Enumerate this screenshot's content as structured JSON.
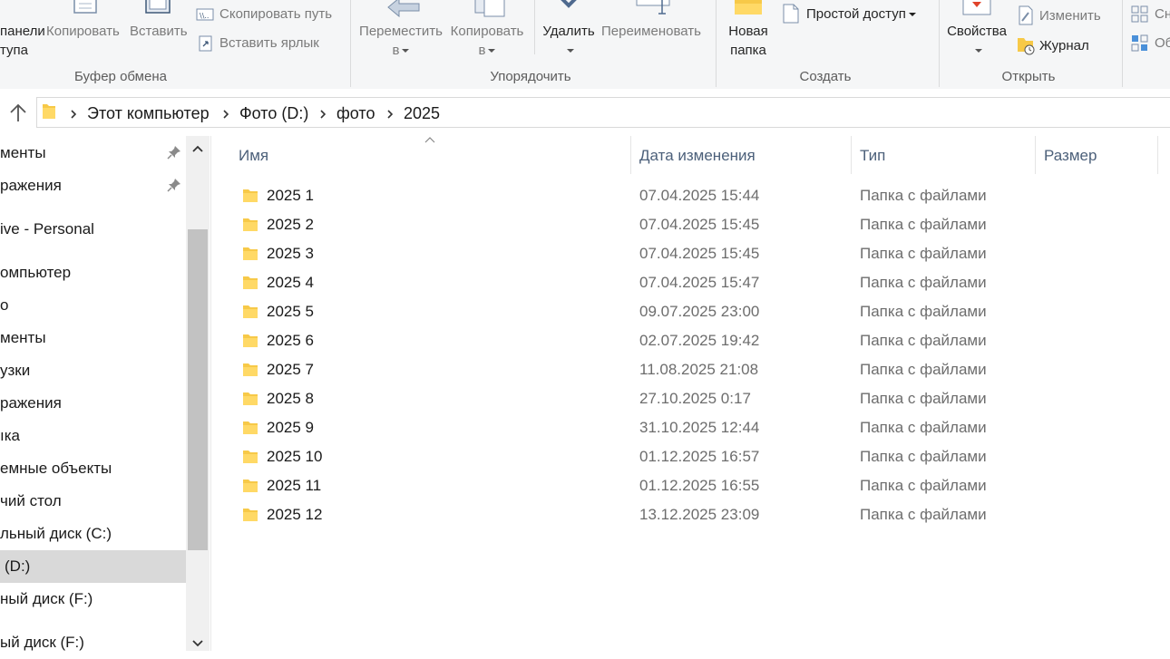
{
  "ribbon": {
    "clipboard": {
      "pin_label_line1": "панели",
      "pin_label_line2": "тупа",
      "copy_label": "Копировать",
      "paste_label": "Вставить",
      "copy_path_label": "Скопировать путь",
      "paste_shortcut_label": "Вставить ярлык",
      "group_label": "Буфер обмена"
    },
    "organize": {
      "move_to_line1": "Переместить",
      "move_to_line2": "в",
      "copy_to_line1": "Копировать",
      "copy_to_line2": "в",
      "delete_label": "Удалить",
      "rename_label": "Переименовать",
      "group_label": "Упорядочить"
    },
    "create": {
      "new_folder_line1": "Новая",
      "new_folder_line2": "папка",
      "easy_access_label": "Простой доступ",
      "group_label": "Создать"
    },
    "open": {
      "properties_label": "Свойства",
      "edit_label": "Изменить",
      "history_label": "Журнал",
      "group_label": "Открыть"
    },
    "select": {
      "item1": "Сн",
      "item2": "Об"
    }
  },
  "address": {
    "crumbs": [
      "Этот компьютер",
      "Фото (D:)",
      "фото",
      "2025"
    ]
  },
  "nav": {
    "items": [
      {
        "label": "менты",
        "pinned": true
      },
      {
        "label": "ражения",
        "pinned": true
      },
      {
        "label": "ive - Personal",
        "pinned": false
      },
      {
        "label": "омпьютер",
        "pinned": false
      },
      {
        "label": "о",
        "pinned": false
      },
      {
        "label": "менты",
        "pinned": false
      },
      {
        "label": "узки",
        "pinned": false
      },
      {
        "label": "ражения",
        "pinned": false
      },
      {
        "label": "ıка",
        "pinned": false
      },
      {
        "label": "емные объекты",
        "pinned": false
      },
      {
        "label": "чий стол",
        "pinned": false
      },
      {
        "label": "льный диск (C:)",
        "pinned": false
      },
      {
        "label": "(D:)",
        "pinned": false,
        "selected": true
      },
      {
        "label": "ный диск (F:)",
        "pinned": false
      },
      {
        "label": "ый диск (F:)",
        "pinned": false
      }
    ]
  },
  "columns": {
    "name": "Имя",
    "date": "Дата изменения",
    "type": "Тип",
    "size": "Размер"
  },
  "files": [
    {
      "name": "2025 1",
      "date": "07.04.2025 15:44",
      "type": "Папка с файлами"
    },
    {
      "name": "2025 2",
      "date": "07.04.2025 15:45",
      "type": "Папка с файлами"
    },
    {
      "name": "2025 3",
      "date": "07.04.2025 15:45",
      "type": "Папка с файлами"
    },
    {
      "name": "2025 4",
      "date": "07.04.2025 15:47",
      "type": "Папка с файлами"
    },
    {
      "name": "2025 5",
      "date": "09.07.2025 23:00",
      "type": "Папка с файлами"
    },
    {
      "name": "2025 6",
      "date": "02.07.2025 19:42",
      "type": "Папка с файлами"
    },
    {
      "name": "2025 7",
      "date": "11.08.2025 21:08",
      "type": "Папка с файлами"
    },
    {
      "name": "2025 8",
      "date": "27.10.2025 0:17",
      "type": "Папка с файлами"
    },
    {
      "name": "2025 9",
      "date": "31.10.2025 12:44",
      "type": "Папка с файлами"
    },
    {
      "name": "2025 10",
      "date": "01.12.2025 16:57",
      "type": "Папка с файлами"
    },
    {
      "name": "2025 11",
      "date": "01.12.2025 16:55",
      "type": "Папка с файлами"
    },
    {
      "name": "2025 12",
      "date": "13.12.2025 23:09",
      "type": "Папка с файлами"
    }
  ],
  "colors": {
    "folder": "#f7c948",
    "header_text": "#4c607a",
    "selected_bg": "#d9d9d9"
  }
}
